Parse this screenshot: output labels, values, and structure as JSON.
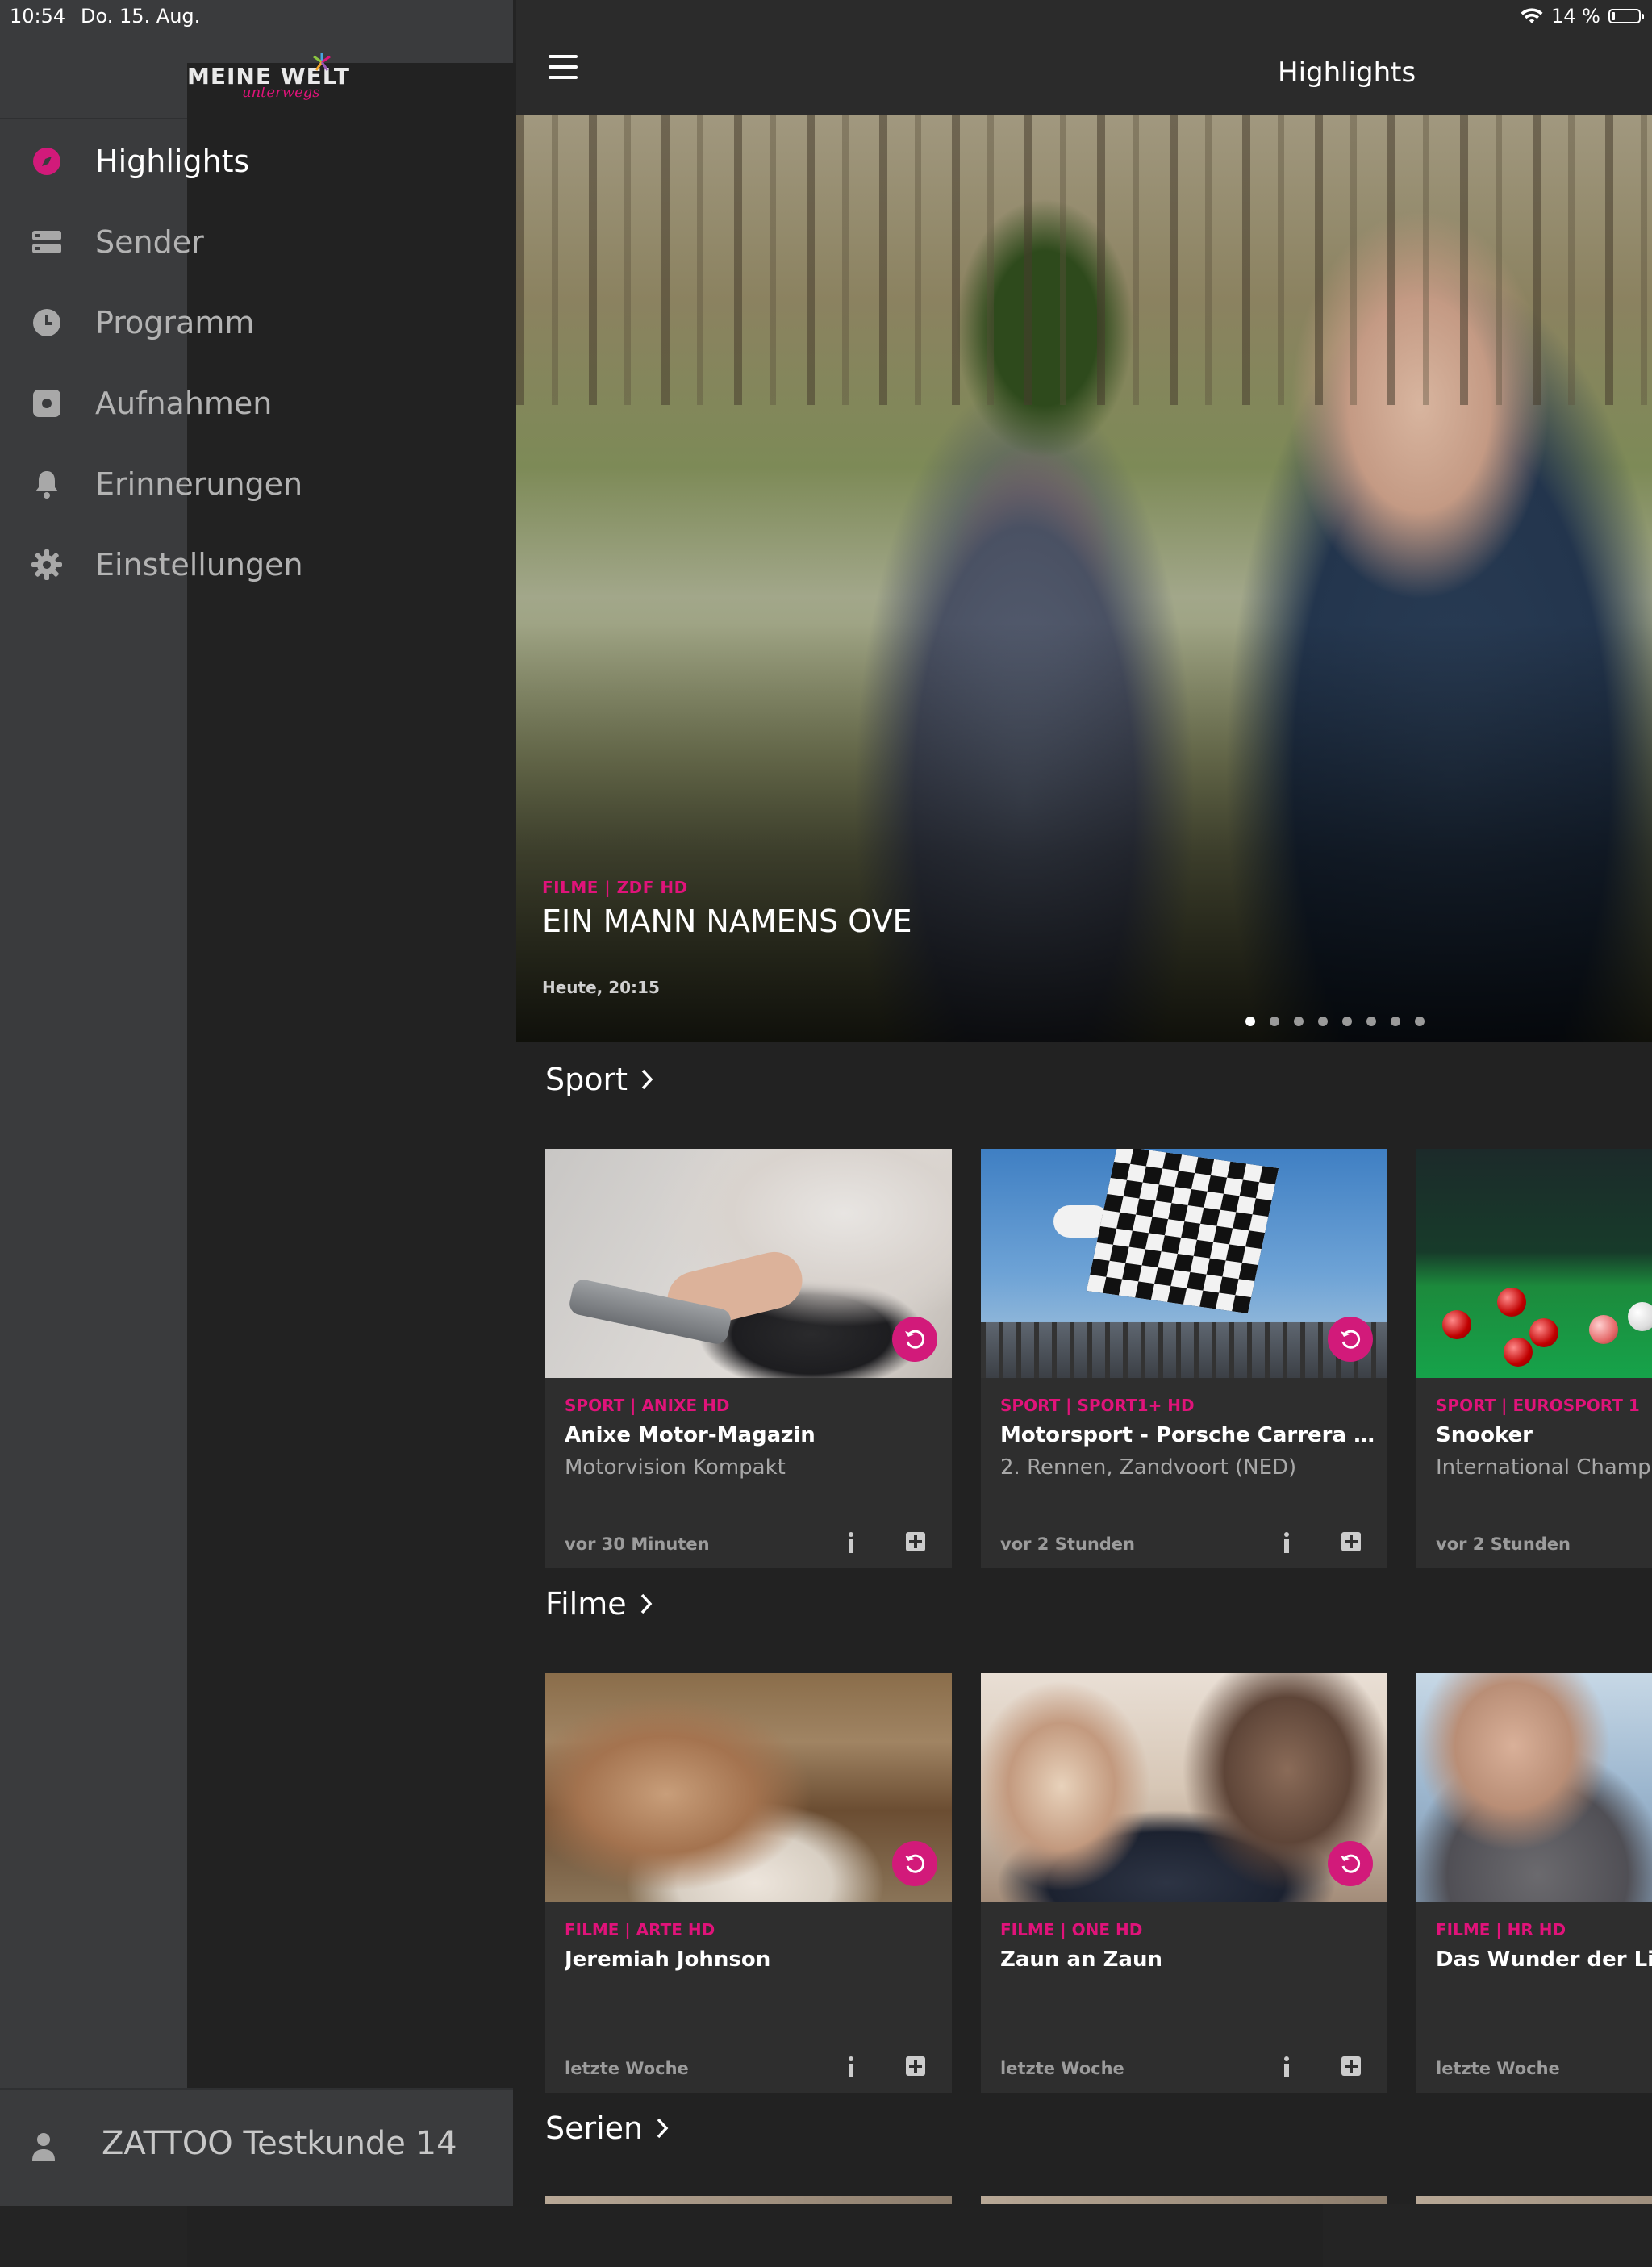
{
  "status_bar": {
    "time": "10:54",
    "date": "Do. 15. Aug.",
    "battery": "14 %"
  },
  "logo": {
    "name": "MEINE WELT",
    "tagline": "unterwegs"
  },
  "sidebar": {
    "items": [
      {
        "label": "Highlights",
        "icon": "compass-icon",
        "active": true
      },
      {
        "label": "Sender",
        "icon": "channels-icon",
        "active": false
      },
      {
        "label": "Programm",
        "icon": "clock-icon",
        "active": false
      },
      {
        "label": "Aufnahmen",
        "icon": "record-icon",
        "active": false
      },
      {
        "label": "Erinnerungen",
        "icon": "bell-icon",
        "active": false
      },
      {
        "label": "Einstellungen",
        "icon": "gear-icon",
        "active": false
      }
    ],
    "user": "ZATTOO Testkunde 14"
  },
  "header": {
    "title": "Highlights"
  },
  "hero": {
    "kicker": "FILME | ZDF HD",
    "title": "EIN MANN NAMENS OVE",
    "time": "Heute, 20:15",
    "slides": 8,
    "active_slide": 1
  },
  "sections": [
    {
      "title": "Sport",
      "cards": [
        {
          "kicker": "SPORT | ANIXE HD",
          "title": "Anixe Motor-Magazin",
          "subtitle": "Motorvision Kompakt",
          "when": "vor 30 Minuten"
        },
        {
          "kicker": "SPORT | SPORT1+ HD",
          "title": "Motorsport - Porsche Carrera Cup,...",
          "subtitle": "2. Rennen, Zandvoort (NED)",
          "when": "vor 2 Stunden"
        },
        {
          "kicker": "SPORT | EUROSPORT 1",
          "title": "Snooker",
          "subtitle": "International Champio",
          "when": "vor 2 Stunden"
        }
      ]
    },
    {
      "title": "Filme",
      "cards": [
        {
          "kicker": "FILME | ARTE HD",
          "title": "Jeremiah Johnson",
          "subtitle": "",
          "when": "letzte Woche"
        },
        {
          "kicker": "FILME | ONE HD",
          "title": "Zaun an Zaun",
          "subtitle": "",
          "when": "letzte Woche"
        },
        {
          "kicker": "FILME | HR HD",
          "title": "Das Wunder der Liebe",
          "subtitle": "",
          "when": "letzte Woche"
        }
      ]
    },
    {
      "title": "Serien",
      "cards": []
    }
  ],
  "colors": {
    "accent": "#e0137a",
    "sidebar_bg": "#3a3b3d",
    "main_bg": "#222222"
  }
}
